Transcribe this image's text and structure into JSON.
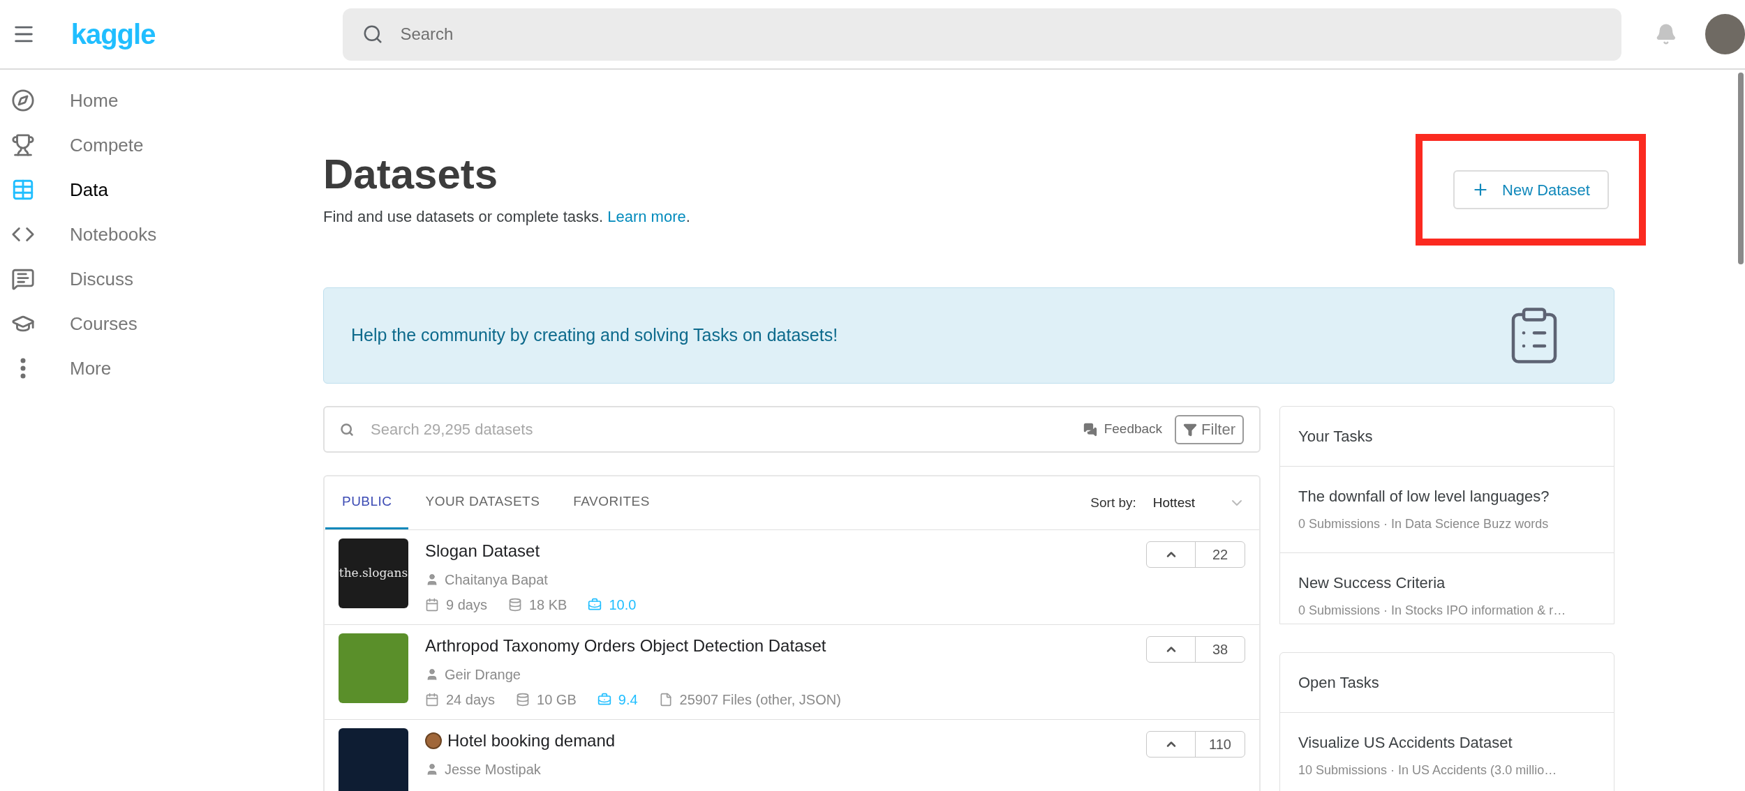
{
  "header": {
    "logo": "kaggle",
    "search": {
      "placeholder": "Search"
    }
  },
  "sidebar": {
    "items": [
      {
        "kind": "home",
        "label": "Home",
        "selected": false
      },
      {
        "kind": "compete",
        "label": "Compete",
        "selected": false
      },
      {
        "kind": "data",
        "label": "Data",
        "selected": true
      },
      {
        "kind": "notebooks",
        "label": "Notebooks",
        "selected": false
      },
      {
        "kind": "discuss",
        "label": "Discuss",
        "selected": false
      },
      {
        "kind": "courses",
        "label": "Courses",
        "selected": false
      },
      {
        "kind": "more",
        "label": "More",
        "selected": false
      }
    ]
  },
  "page": {
    "title": "Datasets",
    "subtitle": "Find and use datasets or complete tasks.",
    "subtitle_link": "Learn more",
    "subtitle_end": ".",
    "new_button": "New Dataset"
  },
  "banner": {
    "text": "Help the community by creating and solving Tasks on datasets!"
  },
  "dataset_search": {
    "placeholder": "Search 29,295 datasets",
    "feedback": "Feedback",
    "filter": "Filter"
  },
  "tabs": [
    {
      "label": "PUBLIC",
      "selected": true
    },
    {
      "label": "YOUR DATASETS",
      "selected": false
    },
    {
      "label": "FAVORITES",
      "selected": false
    }
  ],
  "sort": {
    "label": "Sort by:",
    "value": "Hottest"
  },
  "datasets": [
    {
      "title": "Slogan Dataset",
      "medal": false,
      "author": "Chaitanya Bapat",
      "thumb_text": "the.slogans",
      "meta": [
        {
          "kind": "date",
          "text": "9 days"
        },
        {
          "kind": "size",
          "text": "18 KB"
        },
        {
          "kind": "usability",
          "text": "10.0"
        }
      ],
      "votes": "22"
    },
    {
      "title": "Arthropod Taxonomy Orders Object Detection Dataset",
      "medal": false,
      "author": "Geir Drange",
      "meta": [
        {
          "kind": "date",
          "text": "24 days"
        },
        {
          "kind": "size",
          "text": "10 GB"
        },
        {
          "kind": "usability",
          "text": "9.4"
        },
        {
          "kind": "files",
          "text": "25907 Files (other, JSON)"
        }
      ],
      "votes": "38"
    },
    {
      "title": "Hotel booking demand",
      "medal": true,
      "author": "Jesse Mostipak",
      "votes": "110"
    }
  ],
  "task_panels": [
    {
      "title": "Your Tasks",
      "items": [
        {
          "title": "The downfall of low level languages?",
          "subtitle": "0 Submissions · In Data Science Buzz words"
        },
        {
          "title": "New Success Criteria",
          "subtitle": "0 Submissions · In Stocks IPO information & r…"
        }
      ]
    },
    {
      "title": "Open Tasks",
      "items": [
        {
          "title": "Visualize US Accidents Dataset",
          "subtitle": "10 Submissions · In US Accidents (3.0 millio…"
        }
      ]
    }
  ]
}
